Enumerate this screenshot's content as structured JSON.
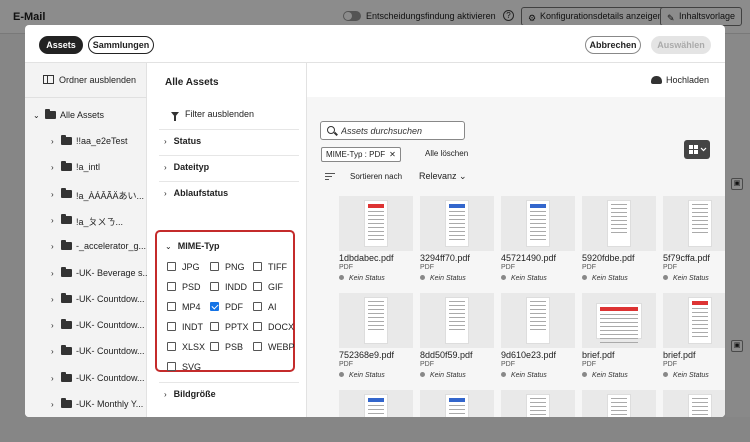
{
  "app": {
    "title": "E-Mail",
    "toggle_label": "Entscheidungsfindung aktivieren",
    "help_icon": "help-icon",
    "config_button": "Konfigurationsdetails anzeigen",
    "template_button": "Inhaltsvorlage"
  },
  "modal": {
    "tabs": [
      {
        "label": "Assets",
        "active": true
      },
      {
        "label": "Sammlungen",
        "active": false
      }
    ],
    "cancel_label": "Abbrechen",
    "select_label": "Auswählen"
  },
  "sidebar": {
    "hide_label": "Ordner ausblenden",
    "root": "Alle Assets",
    "items": [
      {
        "label": "!!aa_e2eTest"
      },
      {
        "label": "!a_intl"
      },
      {
        "label": "!a_ÀÁÂÃÄあい..."
      },
      {
        "label": "!a_ㄆㄨㄋ..."
      },
      {
        "label": "-_accelerator_g..."
      },
      {
        "label": "-UK- Beverage s..."
      },
      {
        "label": "-UK- Countdow..."
      },
      {
        "label": "-UK- Countdow..."
      },
      {
        "label": "-UK- Countdow..."
      },
      {
        "label": "-UK- Countdow..."
      },
      {
        "label": "-UK- Monthly Y..."
      }
    ]
  },
  "filters": {
    "title": "Alle Assets",
    "hide_filter_label": "Filter ausblenden",
    "facets": [
      {
        "label": "Status"
      },
      {
        "label": "Dateityp"
      },
      {
        "label": "Ablaufstatus"
      }
    ],
    "mime": {
      "title": "MIME-Typ",
      "options": [
        {
          "label": "JPG",
          "checked": false
        },
        {
          "label": "PNG",
          "checked": false
        },
        {
          "label": "TIFF",
          "checked": false
        },
        {
          "label": "PSD",
          "checked": false
        },
        {
          "label": "INDD",
          "checked": false
        },
        {
          "label": "GIF",
          "checked": false
        },
        {
          "label": "MP4",
          "checked": false
        },
        {
          "label": "PDF",
          "checked": true
        },
        {
          "label": "AI",
          "checked": false
        },
        {
          "label": "INDT",
          "checked": false
        },
        {
          "label": "PPTX",
          "checked": false
        },
        {
          "label": "DOCX",
          "checked": false
        },
        {
          "label": "XLSX",
          "checked": false
        },
        {
          "label": "PSB",
          "checked": false
        },
        {
          "label": "WEBP",
          "checked": false
        },
        {
          "label": "SVG",
          "checked": false
        }
      ]
    },
    "bottom_facet": "Bildgröße"
  },
  "main": {
    "upload_label": "Hochladen",
    "search_placeholder": "Assets durchsuchen",
    "chip_label": "MIME-Typ : PDF",
    "clear_all": "Alle löschen",
    "sort_label": "Sortieren nach",
    "sort_value": "Relevanz",
    "assets": [
      {
        "name": "1dbdabec.pdf",
        "type": "PDF",
        "status": "Kein Status",
        "style": "red"
      },
      {
        "name": "3294ff70.pdf",
        "type": "PDF",
        "status": "Kein Status",
        "style": "blue"
      },
      {
        "name": "45721490.pdf",
        "type": "PDF",
        "status": "Kein Status",
        "style": "blue"
      },
      {
        "name": "5920fdbe.pdf",
        "type": "PDF",
        "status": "Kein Status",
        "style": "plain"
      },
      {
        "name": "5f79cffa.pdf",
        "type": "PDF",
        "status": "Kein Status",
        "style": "plain"
      },
      {
        "name": "752368e9.pdf",
        "type": "PDF",
        "status": "Kein Status",
        "style": "plain"
      },
      {
        "name": "8dd50f59.pdf",
        "type": "PDF",
        "status": "Kein Status",
        "style": "plain"
      },
      {
        "name": "9d610e23.pdf",
        "type": "PDF",
        "status": "Kein Status",
        "style": "plain"
      },
      {
        "name": "brief.pdf",
        "type": "PDF",
        "status": "Kein Status",
        "style": "wide"
      },
      {
        "name": "brief.pdf",
        "type": "PDF",
        "status": "Kein Status",
        "style": "red"
      },
      {
        "name": "",
        "type": "",
        "status": "",
        "style": "blue"
      },
      {
        "name": "",
        "type": "",
        "status": "",
        "style": "blue"
      },
      {
        "name": "",
        "type": "",
        "status": "",
        "style": "plain"
      },
      {
        "name": "",
        "type": "",
        "status": "",
        "style": "plain"
      },
      {
        "name": "",
        "type": "",
        "status": "",
        "style": "plain"
      }
    ]
  }
}
